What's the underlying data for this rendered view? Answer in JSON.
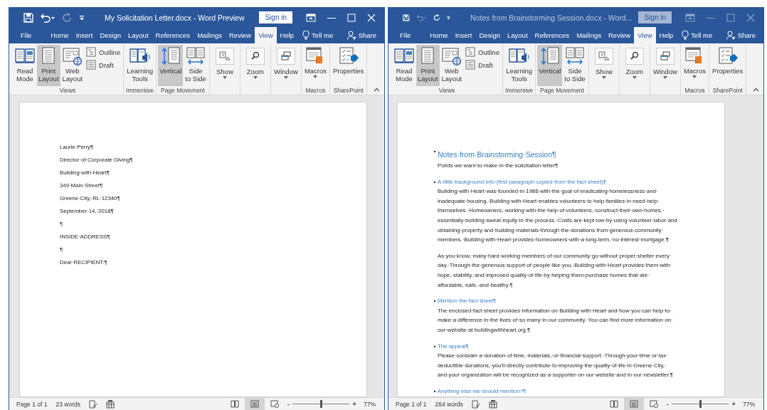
{
  "windows": [
    {
      "title": "My Solicitation Letter.docx - Word Preview",
      "active": true,
      "quick_access": {
        "undo_enabled": true,
        "redo_enabled": false
      },
      "sign_in": "Sign in",
      "tabs": [
        {
          "label": "File",
          "selected": false
        },
        {
          "label": "Home",
          "selected": false
        },
        {
          "label": "Insert",
          "selected": false
        },
        {
          "label": "Design",
          "selected": false
        },
        {
          "label": "Layout",
          "selected": false
        },
        {
          "label": "References",
          "selected": false
        },
        {
          "label": "Mailings",
          "selected": false
        },
        {
          "label": "Review",
          "selected": false
        },
        {
          "label": "View",
          "selected": true
        },
        {
          "label": "Help",
          "selected": false
        }
      ],
      "tell_me": "Tell me",
      "share": "Share",
      "ribbon": [
        {
          "label": "Views",
          "items": [
            {
              "label": "Read\nMode",
              "kind": "large",
              "selected": false
            },
            {
              "label": "Print\nLayout",
              "kind": "large",
              "selected": true
            },
            {
              "label": "Web\nLayout",
              "kind": "large",
              "selected": false
            },
            {
              "label": "Outline",
              "kind": "small",
              "selected": false
            },
            {
              "label": "Draft",
              "kind": "small",
              "selected": false
            }
          ]
        },
        {
          "label": "Immersive",
          "items": [
            {
              "label": "Learning\nTools",
              "kind": "large"
            }
          ]
        },
        {
          "label": "Page Movement",
          "items": [
            {
              "label": "Vertical",
              "kind": "large",
              "selected": true
            },
            {
              "label": "Side\nto Side",
              "kind": "large",
              "selected": false
            }
          ]
        },
        {
          "items": [
            {
              "label": "Show",
              "kind": "dropdown"
            }
          ]
        },
        {
          "items": [
            {
              "label": "Zoom",
              "kind": "dropdown"
            }
          ]
        },
        {
          "items": [
            {
              "label": "Window",
              "kind": "dropdown"
            }
          ]
        },
        {
          "label": "Macros",
          "items": [
            {
              "label": "Macros",
              "kind": "menu"
            }
          ]
        },
        {
          "label": "SharePoint",
          "items": [
            {
              "label": "Properties",
              "kind": "large"
            }
          ]
        }
      ],
      "document": {
        "paragraphs": [
          {
            "kind": "line",
            "lines": [
              "Laurie·Perry¶"
            ]
          },
          {
            "kind": "line",
            "lines": [
              "Director·of·Corporate·Giving¶"
            ]
          },
          {
            "kind": "line",
            "lines": [
              "Building·with·Heart¶"
            ]
          },
          {
            "kind": "line",
            "lines": [
              "349·Main·Street¶"
            ]
          },
          {
            "kind": "line",
            "lines": [
              "Greene·City,·RL·12340¶"
            ]
          },
          {
            "kind": "line",
            "lines": [
              "September·14,·2018¶"
            ]
          },
          {
            "kind": "line",
            "lines": [
              "¶"
            ]
          },
          {
            "kind": "line",
            "lines": [
              "INSIDE·ADDRESS¶"
            ]
          },
          {
            "kind": "line",
            "lines": [
              "¶"
            ]
          },
          {
            "kind": "line",
            "lines": [
              "Dear·RECIPIENT:¶"
            ]
          }
        ]
      },
      "status": {
        "page": "Page 1 of 1",
        "words": "23 words",
        "views": [
          {
            "selected": false
          },
          {
            "selected": true
          },
          {
            "selected": false
          }
        ],
        "zoom_minus": "-",
        "zoom_slider": {
          "level": 0.5
        },
        "zoom_plus": "+",
        "zoom": "77%"
      }
    },
    {
      "title": "Notes from Brainstorming Session.docx - Word...",
      "active": false,
      "quick_access": {
        "undo_enabled": false,
        "redo_enabled": true
      },
      "sign_in": "Sign in",
      "tabs": [
        {
          "label": "File",
          "selected": false
        },
        {
          "label": "Home",
          "selected": false
        },
        {
          "label": "Insert",
          "selected": false
        },
        {
          "label": "Design",
          "selected": false
        },
        {
          "label": "Layout",
          "selected": false
        },
        {
          "label": "References",
          "selected": false
        },
        {
          "label": "Mailings",
          "selected": false
        },
        {
          "label": "Review",
          "selected": false
        },
        {
          "label": "View",
          "selected": true
        },
        {
          "label": "Help",
          "selected": false
        }
      ],
      "tell_me": "Tell me",
      "share": "Share",
      "ribbon": [
        {
          "label": "Views",
          "items": [
            {
              "label": "Read\nMode",
              "kind": "large",
              "selected": false
            },
            {
              "label": "Print\nLayout",
              "kind": "large",
              "selected": true
            },
            {
              "label": "Web\nLayout",
              "kind": "large",
              "selected": false
            },
            {
              "label": "Outline",
              "kind": "small",
              "selected": false
            },
            {
              "label": "Draft",
              "kind": "small",
              "selected": false
            }
          ]
        },
        {
          "label": "Immersive",
          "items": [
            {
              "label": "Learning\nTools",
              "kind": "large"
            }
          ]
        },
        {
          "label": "Page Movement",
          "items": [
            {
              "label": "Vertical",
              "kind": "large",
              "selected": true
            },
            {
              "label": "Side\nto Side",
              "kind": "large",
              "selected": false
            }
          ]
        },
        {
          "items": [
            {
              "label": "Show",
              "kind": "dropdown"
            }
          ]
        },
        {
          "items": [
            {
              "label": "Zoom",
              "kind": "dropdown"
            }
          ]
        },
        {
          "items": [
            {
              "label": "Window",
              "kind": "dropdown"
            }
          ]
        },
        {
          "label": "Macros",
          "items": [
            {
              "label": "Macros",
              "kind": "menu"
            }
          ]
        },
        {
          "label": "SharePoint",
          "items": [
            {
              "label": "Properties",
              "kind": "large"
            }
          ]
        }
      ],
      "document": {
        "paragraphs": [
          {
            "kind": "title",
            "lines": [
              "Notes·from·Brainstorming·Session¶"
            ]
          },
          {
            "kind": "body",
            "lines": [
              "Points·we·want·to·make·in·the·solicitation·letter¶"
            ]
          },
          {
            "kind": "heading",
            "lines": [
              "A·little·background·info·(first·paragraph·copied·from·the·fact·sheet)¶"
            ]
          },
          {
            "kind": "body",
            "lines": [
              "Building·with·Heart·was·founded·in·1986·with·the·goal·of·eradicating·homelessness·and·",
              "inadequate·housing.·Building·with·Heart·enables·volunteers·to·help·families·in·need·help·",
              "themselves.·Homeowners,·working·with·the·help·of·volunteers,·construct·their·own·homes,·",
              "essentially·building·sweat·equity·in·the·process.·Costs·are·kept·low·by·using·volunteer·labor·and·",
              "obtaining·property·and·building·materials·through·the·donations·from·generous·community·",
              "members.·Building·with·Heart·provides·homeowners·with·a·long-term,·no·interest·mortgage.¶"
            ]
          },
          {
            "kind": "body",
            "lines": [
              "As·you·know,·many·hard·working·members·of·our·community·go·without·proper·shelter·every·",
              "day.·Through·the·generous·support·of·people·like·you,·Building·with·Heart·provides·them·with·",
              "hope,·stability,·and·improved·quality·of·life·by·helping·them·purchase·homes·that·are·",
              "affordable,·safe,·and·healthy.¶"
            ]
          },
          {
            "kind": "heading",
            "lines": [
              "Mention·the·fact·sheet¶"
            ]
          },
          {
            "kind": "body",
            "lines": [
              "The·enclosed·fact·sheet·provides·information·on·Building·with·Heart·and·how·you·can·help·to·",
              "make·a·difference·in·the·lives·of·so·many·in·our·community.·You·can·find·more·information·on·",
              "our·website·at·buildingwithheart.org.¶"
            ]
          },
          {
            "kind": "heading",
            "lines": [
              "The·appeal¶"
            ]
          },
          {
            "kind": "body",
            "lines": [
              "Please·consider·a·donation·of·time,·materials,·or·financial·support.·Through·your·time·or·tax·",
              "deductible·donations,·you'll·directly·contribute·to·improving·the·quality·of·life·in·Greene·City,·",
              "and·your·organization·will·be·recognized·as·a·supporter·on·our·website·and·in·our·newsletter.¶"
            ]
          },
          {
            "kind": "heading",
            "lines": [
              "Anything·else·we·should·mention?¶"
            ]
          }
        ]
      },
      "status": {
        "page": "Page 1 of 1",
        "words": "264 words",
        "views": [
          {
            "selected": false
          },
          {
            "selected": true
          },
          {
            "selected": false
          }
        ],
        "zoom_minus": "-",
        "zoom_slider": {
          "level": 0.5
        },
        "zoom_plus": "+",
        "zoom": "77%"
      }
    }
  ]
}
